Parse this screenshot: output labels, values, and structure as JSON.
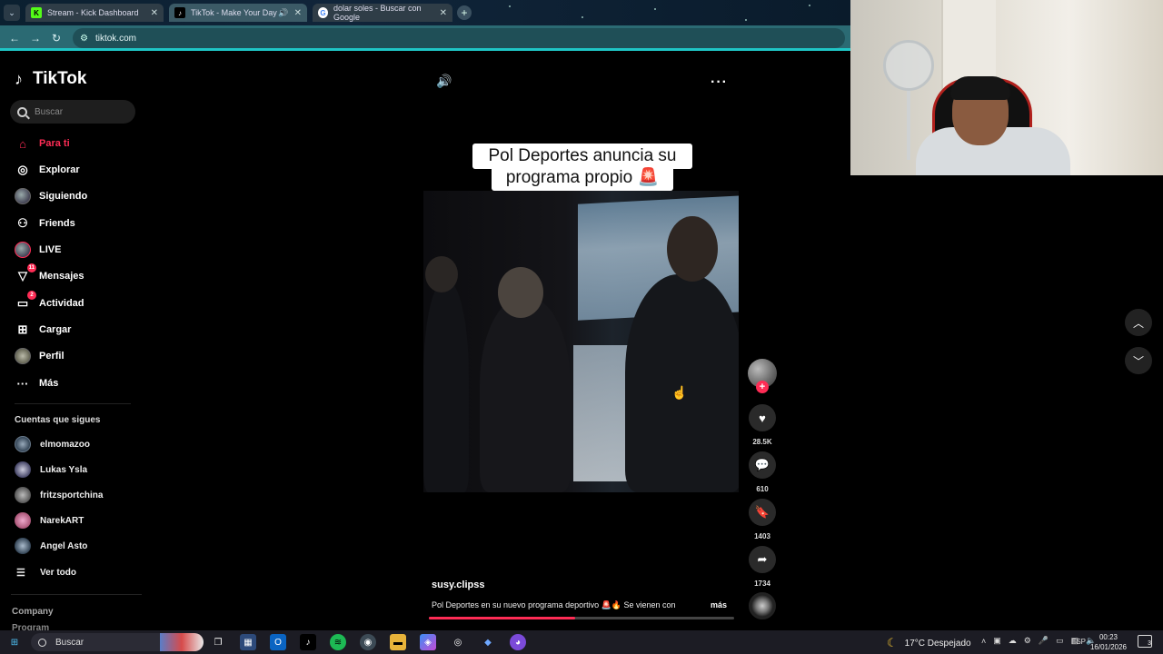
{
  "browser": {
    "tabs": [
      {
        "title": "Stream - Kick Dashboard",
        "favicon": "kick-icon",
        "color": "#53fc18"
      },
      {
        "title": "TikTok - Make Your Day",
        "favicon": "tiktok-icon",
        "active": true
      },
      {
        "title": "dolar soles - Buscar con Google",
        "favicon": "google-icon"
      }
    ],
    "url": "tiktok.com"
  },
  "tiktok": {
    "logo": "TikTok",
    "search_placeholder": "Buscar",
    "nav": [
      {
        "label": "Para ti",
        "icon": "home-icon",
        "active": true
      },
      {
        "label": "Explorar",
        "icon": "compass-icon"
      },
      {
        "label": "Siguiendo",
        "icon": "following-avatar-icon"
      },
      {
        "label": "Friends",
        "icon": "friends-icon"
      },
      {
        "label": "LIVE",
        "icon": "live-icon"
      },
      {
        "label": "Mensajes",
        "icon": "messages-icon",
        "badge": "11"
      },
      {
        "label": "Actividad",
        "icon": "activity-icon",
        "badge": "2"
      },
      {
        "label": "Cargar",
        "icon": "upload-icon"
      },
      {
        "label": "Perfil",
        "icon": "profile-avatar-icon"
      },
      {
        "label": "Más",
        "icon": "more-icon"
      }
    ],
    "following_title": "Cuentas que sigues",
    "following": [
      {
        "name": "elmomazoo"
      },
      {
        "name": "Lukas Ysla"
      },
      {
        "name": "fritzsportchina"
      },
      {
        "name": "NarekART"
      },
      {
        "name": "Angel Asto"
      }
    ],
    "see_all": "Ver todo",
    "footer": {
      "company": "Company",
      "program": "Program"
    }
  },
  "video": {
    "caption_line1": "Pol Deportes anuncia su",
    "caption_line2": "programa propio 🚨",
    "username": "susy.clipss",
    "description": "Pol Deportes en su nuevo programa deportivo 🚨🔥 Se vienen con",
    "more_label": "más",
    "progress": 0.48,
    "likes": "28.5K",
    "comments": "610",
    "saves": "1403",
    "shares": "1734"
  },
  "taskbar": {
    "search_label": "Buscar",
    "weather": "17°C  Despejado",
    "lang": "ESP",
    "time": "00:23",
    "date": "16/01/2026",
    "notifications": "3"
  },
  "colors": {
    "accent": "#fe2c55",
    "address_bar": "#2b6a73"
  }
}
